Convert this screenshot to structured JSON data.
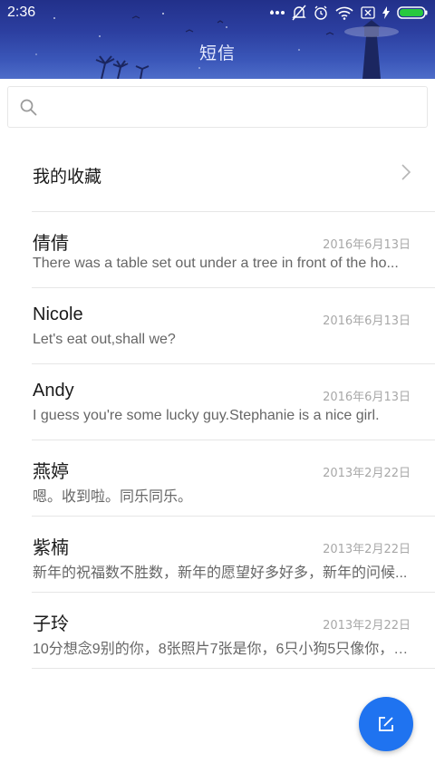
{
  "status_bar": {
    "time": "2:36"
  },
  "header": {
    "title": "短信"
  },
  "search": {
    "placeholder": ""
  },
  "favorites": {
    "label": "我的收藏"
  },
  "conversations": [
    {
      "name": "倩倩",
      "date": "2016年6月13日",
      "preview": "There was a table set out under a tree in front of the ho..."
    },
    {
      "name": "Nicole",
      "date": "2016年6月13日",
      "preview": "Let's eat out,shall we?"
    },
    {
      "name": "Andy",
      "date": "2016年6月13日",
      "preview": "I guess you're some lucky guy.Stephanie is a nice girl."
    },
    {
      "name": "燕婷",
      "date": "2013年2月22日",
      "preview": "嗯。收到啦。同乐同乐。"
    },
    {
      "name": "紫楠",
      "date": "2013年2月22日",
      "preview": "新年的祝福数不胜数，新年的愿望好多好多，新年的问候..."
    },
    {
      "name": "子玲",
      "date": "2013年2月22日",
      "preview": "10分想念9别的你，8张照片7张是你，6只小狗5只像你，4..."
    }
  ],
  "colors": {
    "accent": "#1f73f0",
    "header": "#2c3fa0"
  },
  "icons": {
    "search": "search-icon",
    "chevron": "chevron-right-icon",
    "compose": "compose-icon"
  }
}
